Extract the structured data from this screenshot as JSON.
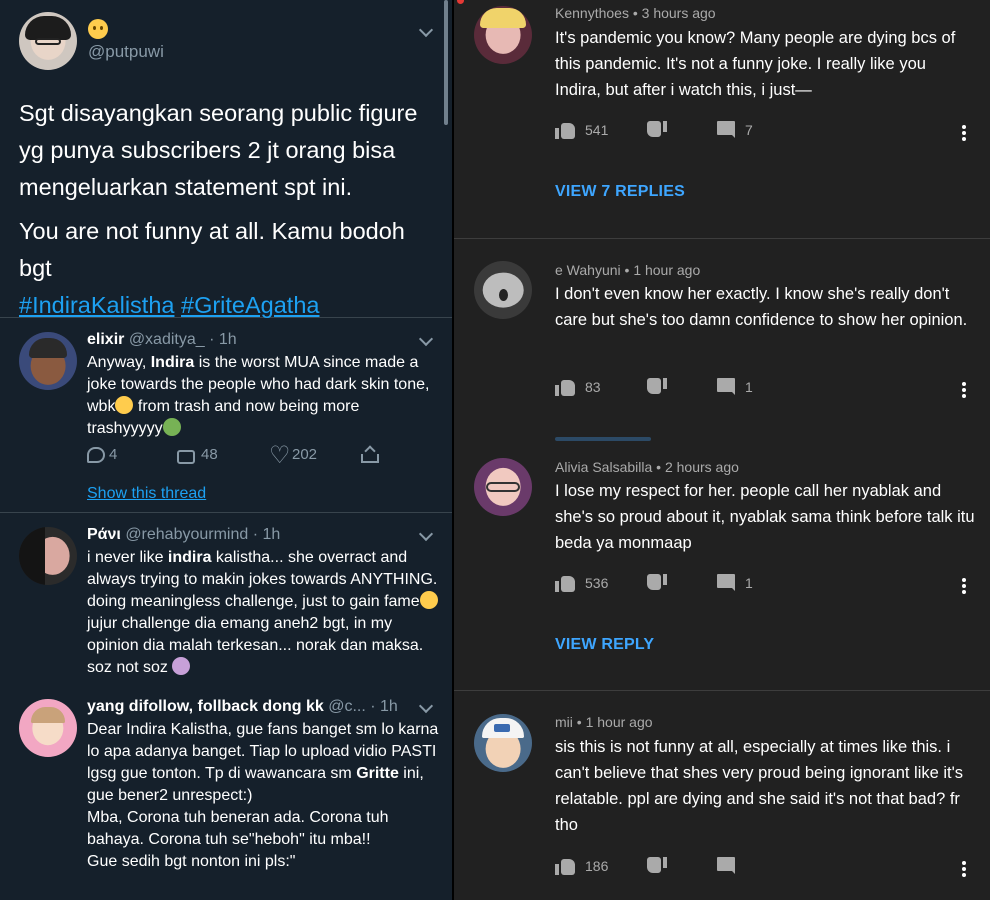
{
  "twitter": {
    "main_tweet": {
      "emoji": "🙂",
      "handle": "@putpuwi",
      "text_line1": "Sgt disayangkan seorang public figure yg punya subscribers 2 jt orang bisa mengeluarkan statement spt ini.",
      "text_line2": "You are not funny at all. Kamu bodoh bgt",
      "hashtag1": "#IndiraKalistha",
      "hashtag2": "#GriteAgatha"
    },
    "replies": [
      {
        "name": "elixir",
        "meta": "@xaditya_ · 1h",
        "body_pre": "Anyway, ",
        "body_bold": "Indira",
        "body_mid": " is the worst MUA since made a joke towards the people who had dark skin tone, wbk",
        "body_mid2": " from trash and now being more trashyyyyy",
        "replies": "4",
        "retweets": "48",
        "likes": "202",
        "show_thread": "Show this thread"
      },
      {
        "name": "Ράνι",
        "meta": "@rehabyourmind · 1h",
        "body_pre": "i never like ",
        "body_bold": "indira",
        "body_mid": " kalistha... she overract and always trying to makin jokes towards ANYTHING. doing meaningless challenge, just to gain fame",
        "body_mid2": " jujur challenge dia emang aneh2 bgt, in my opinion dia malah terkesan... norak dan maksa. soz not soz"
      },
      {
        "name": "yang difollow, follback dong kk",
        "meta": "@c... · 1h",
        "body_l1": "Dear Indira Kalistha, gue fans banget sm lo karna lo apa adanya banget. Tiap lo upload vidio PASTI lgsg gue tonton. Tp di wawancara sm ",
        "body_bold": "Gritte",
        "body_l1b": " ini, gue bener2 unrespect:)",
        "body_l2": "Mba, Corona tuh beneran ada. Corona tuh bahaya. Corona tuh se\"heboh\" itu mba!!",
        "body_l3": "Gue sedih bgt nonton ini pls:\""
      }
    ]
  },
  "youtube": {
    "comments": [
      {
        "author": "Kennythoes",
        "time": "3 hours ago",
        "text": "It's pandemic you know? Many people are dying bcs of this pandemic. It's not a funny joke. I really like you Indira, but after i watch this, i just—",
        "likes": "541",
        "replies": "7",
        "view_replies": "VIEW 7 REPLIES"
      },
      {
        "author": "e Wahyuni",
        "time": "1 hour ago",
        "text": "I don't even know her exactly. I know she's really don't care but she's too damn confidence to show her opinion.",
        "likes": "83",
        "replies": "1"
      },
      {
        "author": "Alivia Salsabilla",
        "time": "2 hours ago",
        "text": "I lose my respect for her. people call her nyablak and she's so proud about it, nyablak sama think before talk itu beda ya monmaap",
        "likes": "536",
        "replies": "1",
        "view_replies": "VIEW REPLY"
      },
      {
        "author": "mii",
        "time": "1 hour ago",
        "text": "sis this is not funny at all, especially at times like this. i can't believe that shes very proud being ignorant like it's relatable. ppl are dying and she said it's not that bad? fr tho",
        "likes": "186",
        "replies": ""
      }
    ]
  }
}
